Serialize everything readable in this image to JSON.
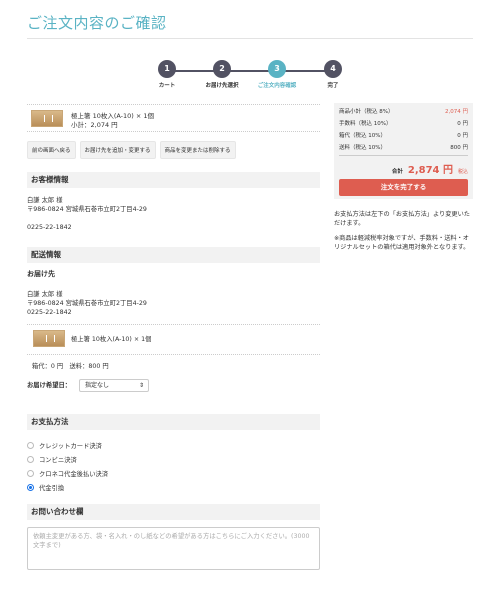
{
  "page": {
    "title": "ご注文内容のご確認"
  },
  "steps": [
    {
      "num": "1",
      "label": "カート"
    },
    {
      "num": "2",
      "label": "お届け先選択"
    },
    {
      "num": "3",
      "label": "ご注文内容確認"
    },
    {
      "num": "4",
      "label": "完了"
    }
  ],
  "cart_item": {
    "name": "極上箸 10枚入(A-10) × 1個",
    "subtotal": "小計：2,074 円"
  },
  "cart_buttons": {
    "back": "前の画面へ戻る",
    "add_address": "お届け先を追加・変更する",
    "change_item": "商品を変更または削除する"
  },
  "customer": {
    "heading": "お客様情報",
    "name": "白謙 太郎 様",
    "address": "〒986-0824 宮城県石巻市立町2丁目4-29",
    "phone": "0225-22-1842"
  },
  "delivery": {
    "heading": "配送情報",
    "subheading": "お届け先",
    "name": "白謙 太郎 様",
    "address": "〒986-0824 宮城県石巻市立町2丁目4-29",
    "phone": "0225-22-1842",
    "item": "極上箸 10枚入(A-10) × 1個",
    "fees": "箱代：0 円　送料：800 円",
    "date_label": "お届け希望日：",
    "date_value": "指定なし"
  },
  "payment": {
    "heading": "お支払方法",
    "options": [
      "クレジットカード決済",
      "コンビニ決済",
      "クロネコ代金後払い決済",
      "代金引換"
    ],
    "selected_index": 3
  },
  "inquiry": {
    "heading": "お問い合わせ欄",
    "placeholder": "依頼主変更がある方、袋・名入れ・のし紙などの希望がある方はこちらにご入力ください。(3000文字まで)"
  },
  "summary": {
    "rows": [
      {
        "label": "商品小計（税込 8%）",
        "value": "2,074 円"
      },
      {
        "label": "手数料（税込 10%）",
        "value": "0 円"
      },
      {
        "label": "箱代（税込 10%）",
        "value": "0 円"
      },
      {
        "label": "送料（税込 10%）",
        "value": "800 円"
      }
    ],
    "total_label": "合計",
    "total_value": "2,874 円",
    "total_tax": "税込",
    "submit": "注文を完了する",
    "note1": "お支払方法は左下の「お支払方法」より変更いただけます。",
    "note2": "※商品は軽減税率対象ですが、手数料・送料・オリジナルセットの箱代は適用対象外となります。"
  },
  "colors": {
    "accent": "#5ab3c4",
    "step_dark": "#525263",
    "price_red": "#de5d50",
    "radio_blue": "#1a73e8"
  }
}
